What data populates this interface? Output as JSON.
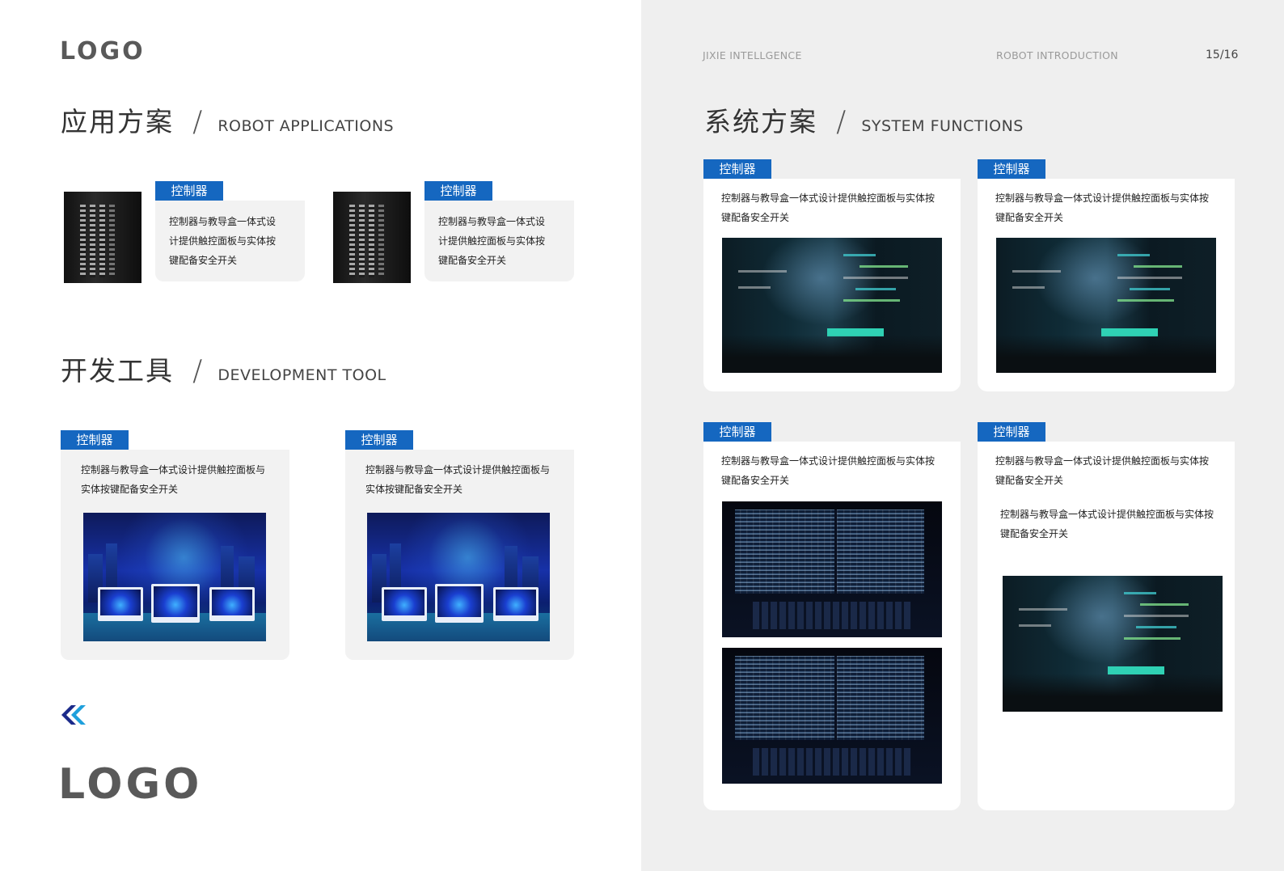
{
  "left": {
    "logo_top": "LOGO",
    "logo_bottom": "LOGO",
    "section1": {
      "cn": "应用方案",
      "slash": "/",
      "en": "ROBOT  APPLICATIONS"
    },
    "section2": {
      "cn": "开发工具",
      "slash": "/",
      "en": "DEVELOPMENT  TOOL"
    },
    "app_cards": [
      {
        "tag": "控制器",
        "lines": [
          "控制器与教导盒一体式设",
          "计提供触控面板与实体按",
          "键配备安全开关"
        ]
      },
      {
        "tag": "控制器",
        "lines": [
          "控制器与教导盒一体式设",
          "计提供触控面板与实体按",
          "键配备安全开关"
        ]
      }
    ],
    "dev_cards": [
      {
        "tag": "控制器",
        "lines": [
          "控制器与教导盒一体式设计提供触控面板与",
          "实体按键配备安全开关"
        ]
      },
      {
        "tag": "控制器",
        "lines": [
          "控制器与教导盒一体式设计提供触控面板与",
          "实体按键配备安全开关"
        ]
      }
    ],
    "chevron_icon": "double-chevron-left-icon",
    "accent_color": "#1567c0"
  },
  "right": {
    "header_left": "JIXIE  INTELLGENCE",
    "header_mid": "ROBOT  INTRODUCTION",
    "page_number": "15/16",
    "section": {
      "cn": "系统方案",
      "slash": "/",
      "en": "SYSTEM  FUNCTIONS"
    },
    "cards": [
      {
        "tag": "控制器",
        "lines": [
          "控制器与教导盒一体式设计提供触控面板与实体按",
          "键配备安全开关"
        ]
      },
      {
        "tag": "控制器",
        "lines": [
          "控制器与教导盒一体式设计提供触控面板与实体按",
          "键配备安全开关"
        ]
      },
      {
        "tag": "控制器",
        "lines": [
          "控制器与教导盒一体式设计提供触控面板与实体按",
          "键配备安全开关"
        ]
      },
      {
        "tag": "控制器",
        "lines": [
          "控制器与教导盒一体式设计提供触控面板与实体按",
          "键配备安全开关"
        ],
        "extra_lines": [
          "控制器与教导盒一体式设计提供触控面板与实体按",
          "键配备安全开关"
        ]
      }
    ]
  }
}
